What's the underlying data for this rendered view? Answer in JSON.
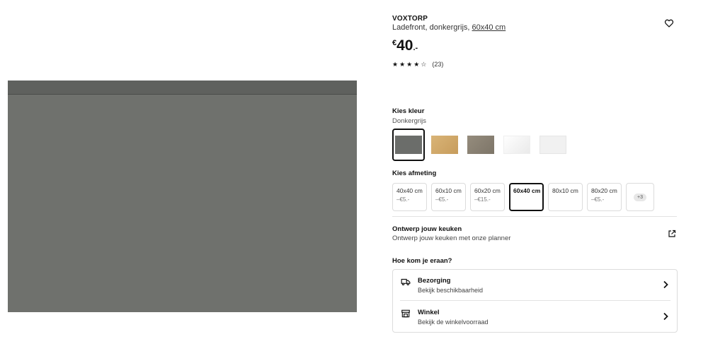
{
  "product": {
    "brand": "VOXTORP",
    "description": "Ladefront, donkergrijs,",
    "size_link": "60x40 cm",
    "price": {
      "currency": "€",
      "amount": "40",
      "decimal": ".-"
    },
    "rating": {
      "stars": 4,
      "max": 5,
      "reviews": "(23)"
    }
  },
  "colour": {
    "label": "Kies kleur",
    "selected": "Donkergrijs",
    "swatches": [
      {
        "name": "donkergrijs",
        "color": "#6b6d6a"
      },
      {
        "name": "eiken",
        "color": "#d3ac6c"
      },
      {
        "name": "walnoot",
        "color": "#8a8275"
      },
      {
        "name": "hoogglans wit",
        "color": "#f3f3f3"
      },
      {
        "name": "mat wit",
        "color": "#f1f1f1"
      }
    ]
  },
  "size": {
    "label": "Kies afmeting",
    "options": [
      {
        "size": "40x40 cm",
        "price": "–€5.-"
      },
      {
        "size": "60x10 cm",
        "price": "–€5.-"
      },
      {
        "size": "60x20 cm",
        "price": "–€15.-"
      },
      {
        "size": "60x40 cm",
        "price": ""
      },
      {
        "size": "80x10 cm",
        "price": ""
      },
      {
        "size": "80x20 cm",
        "price": "–€5.-"
      }
    ],
    "more": "+3"
  },
  "planner": {
    "title": "Ontwerp jouw keuken",
    "subtitle": "Ontwerp jouw keuken met onze planner"
  },
  "delivery": {
    "heading": "Hoe kom je eraan?",
    "options": [
      {
        "title": "Bezorging",
        "subtitle": "Bekijk beschikbaarheid"
      },
      {
        "title": "Winkel",
        "subtitle": "Bekijk de winkelvoorraad"
      }
    ]
  }
}
